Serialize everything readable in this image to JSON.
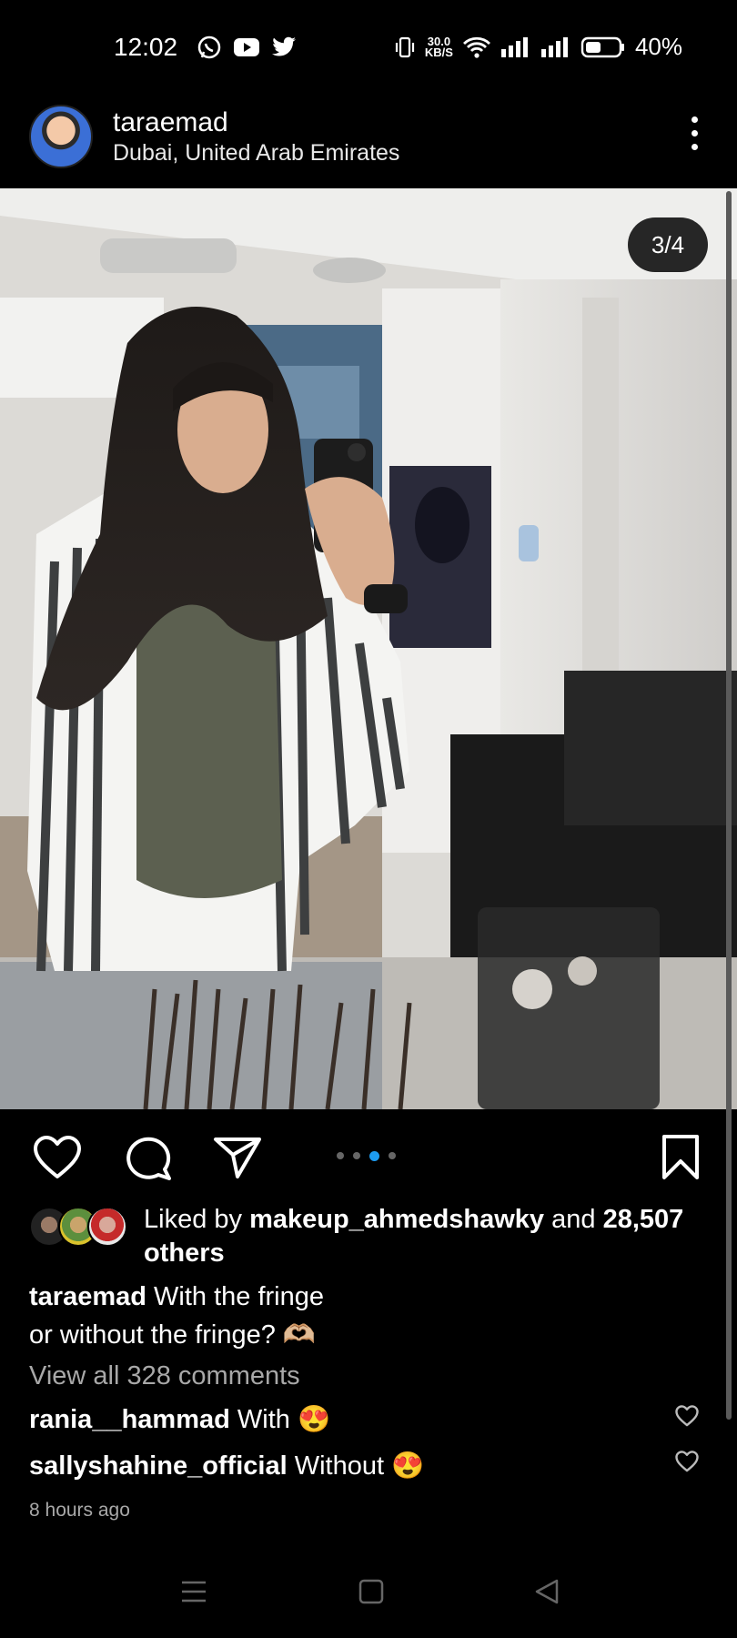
{
  "status_bar": {
    "time": "12:02",
    "apps": [
      "whatsapp-icon",
      "youtube-icon",
      "twitter-icon"
    ],
    "net_speed_value": "30.0",
    "net_speed_unit": "KB/S",
    "battery": "40%"
  },
  "post": {
    "username": "taraemad",
    "location": "Dubai, United Arab Emirates",
    "image_counter": "3/4",
    "carousel_total": 4,
    "carousel_active": 3,
    "likes_prefix": "Liked by ",
    "likes_user": "makeup_ahmedshawky",
    "likes_and": " and ",
    "likes_count": "28,507",
    "likes_others": "others",
    "caption_user": "taraemad",
    "caption_line1": "With the fringe",
    "caption_line2": "or without the fringe? 🫶🏼",
    "view_all": "View all 328 comments",
    "comments": [
      {
        "user": "rania__hammad",
        "text": "With 😍"
      },
      {
        "user": "sallyshahine_official",
        "text": "Without 😍"
      }
    ],
    "time_ago": "8 hours ago"
  },
  "colors": {
    "background": "#000000",
    "carousel_active_dot": "#1d9bf0",
    "muted_text": "#a8a8a8"
  }
}
